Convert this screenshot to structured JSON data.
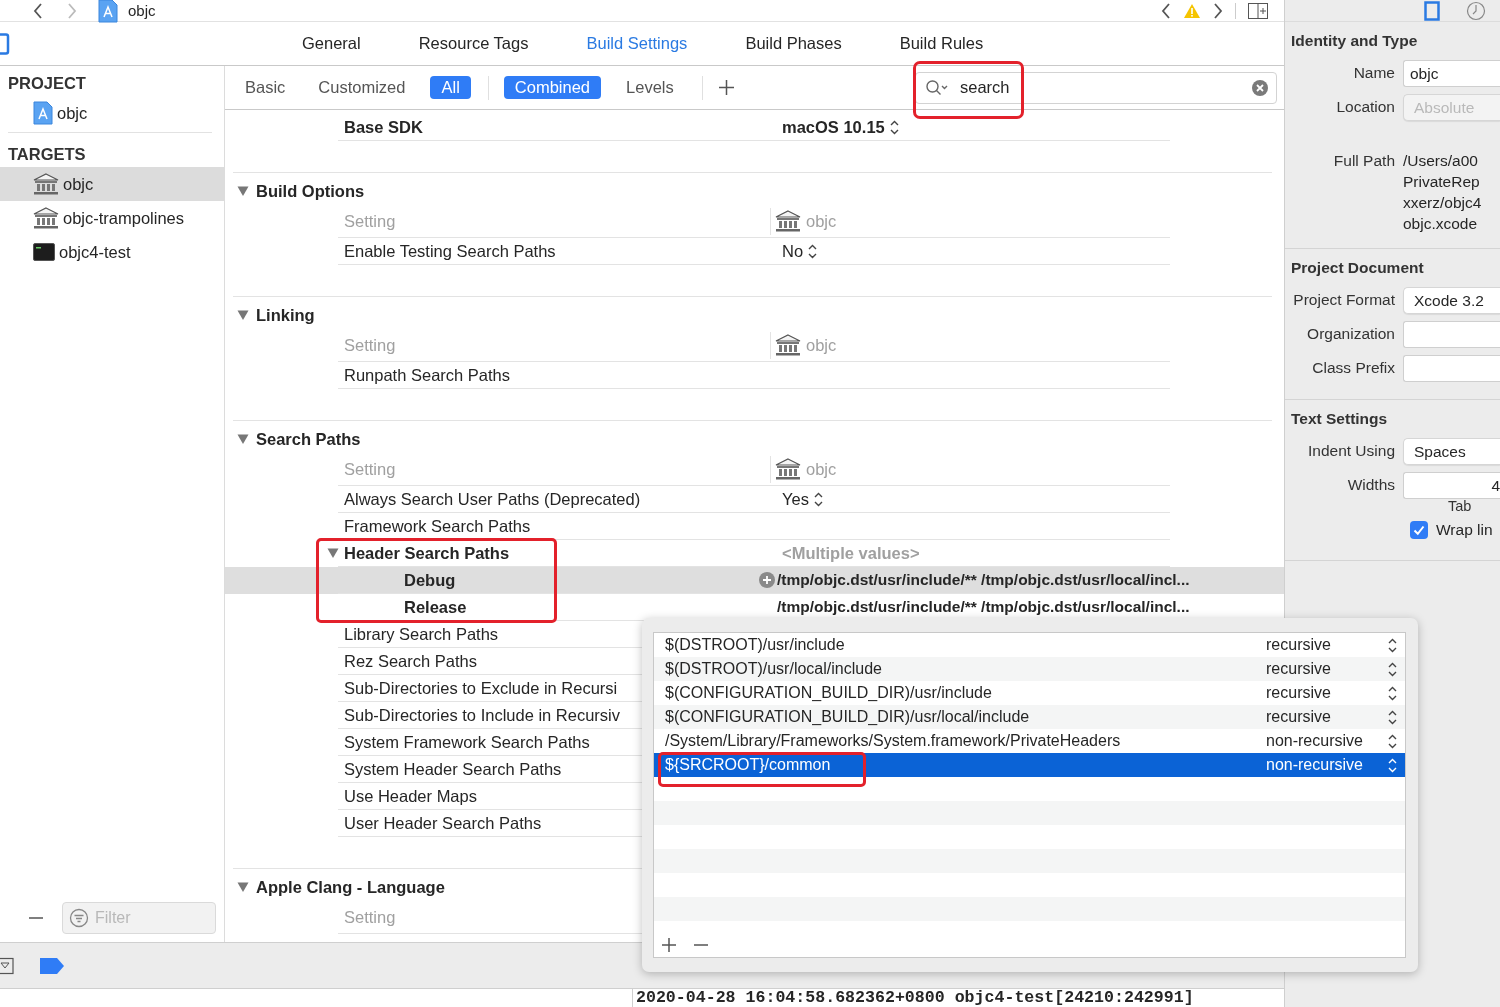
{
  "breadcrumb": {
    "title": "objc"
  },
  "editor_tabs": [
    {
      "label": "General",
      "selected": false
    },
    {
      "label": "Resource Tags",
      "selected": false
    },
    {
      "label": "Build Settings",
      "selected": true
    },
    {
      "label": "Build Phases",
      "selected": false
    },
    {
      "label": "Build Rules",
      "selected": false
    }
  ],
  "navigator": {
    "groups": [
      {
        "title": "PROJECT",
        "items": [
          {
            "label": "objc",
            "kind": "project",
            "selected": false
          }
        ]
      },
      {
        "title": "TARGETS",
        "items": [
          {
            "label": "objc",
            "kind": "library",
            "selected": true
          },
          {
            "label": "objc-trampolines",
            "kind": "library",
            "selected": false
          },
          {
            "label": "objc4-test",
            "kind": "tool",
            "selected": false
          }
        ]
      }
    ],
    "filter": {
      "placeholder": "Filter"
    }
  },
  "filter_bar": {
    "scopes": [
      {
        "label": "Basic",
        "selected": false
      },
      {
        "label": "Customized",
        "selected": false
      },
      {
        "label": "All",
        "selected": true
      }
    ],
    "views": [
      {
        "label": "Combined",
        "selected": true
      },
      {
        "label": "Levels",
        "selected": false
      }
    ],
    "search": {
      "value": "search",
      "highlighted": true
    }
  },
  "settings": {
    "sections": [
      {
        "rows": [
          {
            "kind": "setting",
            "name": "Base SDK",
            "value": "macOS 10.15",
            "customized": true,
            "popup": true
          }
        ]
      },
      {
        "title": "Build Options",
        "expanded": true,
        "header": {
          "label": "Setting",
          "target": "objc"
        },
        "rows": [
          {
            "kind": "setting",
            "name": "Enable Testing Search Paths",
            "value": "No",
            "customized": false,
            "popup": true
          }
        ]
      },
      {
        "title": "Linking",
        "expanded": true,
        "header": {
          "label": "Setting",
          "target": "objc"
        },
        "rows": [
          {
            "kind": "setting",
            "name": "Runpath Search Paths",
            "customized": false
          }
        ]
      },
      {
        "title": "Search Paths",
        "expanded": true,
        "header": {
          "label": "Setting",
          "target": "objc"
        },
        "rows": [
          {
            "kind": "setting",
            "name": "Always Search User Paths (Deprecated)",
            "value": "Yes",
            "customized": false,
            "popup": true
          },
          {
            "kind": "setting",
            "name": "Framework Search Paths",
            "customized": false
          },
          {
            "kind": "group",
            "name": "Header Search Paths",
            "value": "<Multiple values>",
            "customized": true,
            "expanded": true,
            "highlighted": true,
            "children": [
              {
                "name": "Debug",
                "value": "/tmp/objc.dst/usr/include/** /tmp/objc.dst/usr/local/incl...",
                "selected": true
              },
              {
                "name": "Release",
                "value": "/tmp/objc.dst/usr/include/** /tmp/objc.dst/usr/local/incl...",
                "selected": false
              }
            ]
          },
          {
            "kind": "setting",
            "name": "Library Search Paths",
            "customized": false
          },
          {
            "kind": "setting",
            "name": "Rez Search Paths",
            "customized": false
          },
          {
            "kind": "setting",
            "name": "Sub-Directories to Exclude in Recursi",
            "customized": false
          },
          {
            "kind": "setting",
            "name": "Sub-Directories to Include in Recursiv",
            "customized": false
          },
          {
            "kind": "setting",
            "name": "System Framework Search Paths",
            "customized": false
          },
          {
            "kind": "setting",
            "name": "System Header Search Paths",
            "customized": false
          },
          {
            "kind": "setting",
            "name": "Use Header Maps",
            "customized": false
          },
          {
            "kind": "setting",
            "name": "User Header Search Paths",
            "customized": false
          }
        ]
      },
      {
        "title": "Apple Clang - Language",
        "expanded": true,
        "header": {
          "label": "Setting"
        }
      }
    ]
  },
  "inspector": {
    "sections": [
      {
        "title": "Identity and Type",
        "fields": [
          {
            "label": "Name",
            "kind": "text",
            "value": "objc"
          },
          {
            "label": "Location",
            "kind": "popup",
            "value": "Absolute",
            "disabled": true
          },
          {
            "label": "Full Path",
            "kind": "path",
            "lines": [
              "/Users/a00",
              "PrivateRep",
              "xxerz/objc4",
              "objc.xcode"
            ]
          }
        ]
      },
      {
        "title": "Project Document",
        "fields": [
          {
            "label": "Project Format",
            "kind": "popup",
            "value": "Xcode 3.2",
            "disabled": false
          },
          {
            "label": "Organization",
            "kind": "text"
          },
          {
            "label": "Class Prefix",
            "kind": "text"
          }
        ]
      },
      {
        "title": "Text Settings",
        "fields": [
          {
            "label": "Indent Using",
            "kind": "popup",
            "value": "Spaces",
            "disabled": false
          },
          {
            "label": "Widths",
            "kind": "text",
            "value": "4",
            "caption": "Tab"
          },
          {
            "label": "Wrap lin",
            "kind": "checkbox",
            "checked": true
          }
        ]
      }
    ]
  },
  "console": {
    "text": "2020-04-28 16:04:58.682362+0800 objc4-test[24210:242991]"
  },
  "popover": {
    "rows": [
      {
        "path": "$(DSTROOT)/usr/include",
        "mode": "recursive",
        "selected": false,
        "highlighted": false
      },
      {
        "path": "$(DSTROOT)/usr/local/include",
        "mode": "recursive",
        "selected": false,
        "highlighted": false
      },
      {
        "path": "$(CONFIGURATION_BUILD_DIR)/usr/include",
        "mode": "recursive",
        "selected": false,
        "highlighted": false
      },
      {
        "path": "$(CONFIGURATION_BUILD_DIR)/usr/local/include",
        "mode": "recursive",
        "selected": false,
        "highlighted": false
      },
      {
        "path": "/System/Library/Frameworks/System.framework/PrivateHeaders",
        "mode": "non-recursive",
        "selected": false,
        "highlighted": false
      },
      {
        "path": "${SRCROOT}/common",
        "mode": "non-recursive",
        "selected": true,
        "highlighted": true
      }
    ]
  }
}
